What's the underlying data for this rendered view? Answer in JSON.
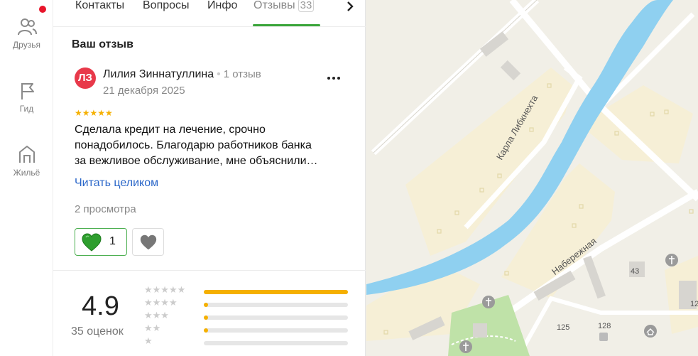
{
  "rail": {
    "items": [
      {
        "label": "Друзья",
        "icon": "friends-icon"
      },
      {
        "label": "Гид",
        "icon": "flag-icon"
      },
      {
        "label": "Жильё",
        "icon": "house-icon"
      }
    ]
  },
  "tabs": {
    "items": [
      {
        "label": "Контакты"
      },
      {
        "label": "Вопросы"
      },
      {
        "label": "Инфо"
      },
      {
        "label": "Отзывы",
        "count": "33",
        "active": true
      }
    ]
  },
  "review": {
    "section_title": "Ваш отзыв",
    "avatar_initials": "ЛЗ",
    "author": "Лилия Зиннатуллина",
    "author_reviews": "1 отзыв",
    "date": "21 декабря 2025",
    "rating": 5,
    "text_lines": [
      "Сделала кредит на лечение, срочно",
      "понадобилось. Благодарю работников банка",
      "за вежливое обслуживание, мне объяснили…"
    ],
    "read_more": "Читать целиком",
    "views": "2 просмотра",
    "likes": "1"
  },
  "rating_summary": {
    "score": "4.9",
    "count_label": "35 оценок",
    "distribution": [
      {
        "stars": 5,
        "fraction": 1.0
      },
      {
        "stars": 4,
        "fraction": 0.03
      },
      {
        "stars": 3,
        "fraction": 0.03
      },
      {
        "stars": 2,
        "fraction": 0.03
      },
      {
        "stars": 1,
        "fraction": 0.0
      }
    ]
  },
  "map": {
    "street_labels": [
      "Карла Либкнехта",
      "Набережная"
    ],
    "house_numbers": [
      "43",
      "125",
      "128",
      "12"
    ]
  },
  "colors": {
    "accent_green": "#3aa53a",
    "star_yellow": "#f5b000",
    "link_blue": "#2b67c9",
    "avatar_red": "#e8394a",
    "river_blue": "#8fd0f0"
  }
}
